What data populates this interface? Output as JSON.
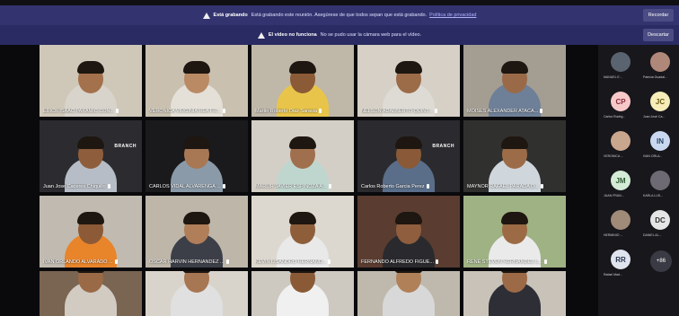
{
  "banner_recording": {
    "title": "Está grabando",
    "text": "Está grabando este reunión. Asegúrese de que todos sepan que está grabando.",
    "link": "Política de privacidad",
    "button": "Recordar"
  },
  "banner_video": {
    "title": "El vídeo no funciona",
    "text": "No se pudo usar la cámara web para el vídeo.",
    "button": "Descartar"
  },
  "tile_logo_text": "BRANCH",
  "tiles": [
    {
      "name": "ERICK ISAAC PAXAMIC CON...",
      "bg": "#cfc7b8",
      "shirt": "#d8d3cb",
      "skin": "#a3714c"
    },
    {
      "name": "VERONICA VIRGINIA REA FR...",
      "bg": "#c9c0b0",
      "shirt": "#e4e0d8",
      "skin": "#b98a64"
    },
    {
      "name": "Martin Roberto Diaz Saravia",
      "bg": "#bfb7a8",
      "shirt": "#e8c54a",
      "skin": "#8b5a36"
    },
    {
      "name": "NELSON ADALBERTO QUINT...",
      "bg": "#d6d0c6",
      "shirt": "#dedbd4",
      "skin": "#9c6b48"
    },
    {
      "name": "MOISES ALEXANDER ATACA...",
      "bg": "#a39d92",
      "shirt": "#6e7f98",
      "skin": "#9a6a48"
    },
    {
      "name": "Juan Jose Caceres Chiquillo",
      "bg": "#2c2c30",
      "shirt": "#b7bdc6",
      "skin": "#8e5e3c"
    },
    {
      "name": "CARLOS VIDAL ALVARENGA ...",
      "bg": "#1a1a1d",
      "shirt": "#8a9aa8",
      "skin": "#a87854"
    },
    {
      "name": "MARLIR JAVIER ESPINOZA A...",
      "bg": "#d4cfc6",
      "shirt": "#bfd6cf",
      "skin": "#a0704e"
    },
    {
      "name": "Carlos Roberto Garcia Perez",
      "bg": "#2b2b2f",
      "shirt": "#5a6e8a",
      "skin": "#8a5a38"
    },
    {
      "name": "MAYNOR RAFAEL PARADA D...",
      "bg": "#30302f",
      "shirt": "#cfd6dc",
      "skin": "#9c6c48"
    },
    {
      "name": "IVAN ORLANDO ALVARADO ...",
      "bg": "#c0bab0",
      "shirt": "#e8842a",
      "skin": "#8c5a36"
    },
    {
      "name": "OSCAR HARVIN HERNANDEZ ...",
      "bg": "#bdb6a9",
      "shirt": "#3c3f48",
      "skin": "#b07e58"
    },
    {
      "name": "KEVIN LISANDRO HERNAND...",
      "bg": "#ddd8cf",
      "shirt": "#e9e9e9",
      "skin": "#8e5e3a"
    },
    {
      "name": "FERNANDO ALFREDO FIGUE...",
      "bg": "#5a3c30",
      "shirt": "#2a2a2e",
      "skin": "#8e5e3e"
    },
    {
      "name": "RENE STEVEN HERNANDEZ L...",
      "bg": "#9fb284",
      "shirt": "#eaeaea",
      "skin": "#9c6a44"
    },
    {
      "name": "",
      "bg": "#7a6452",
      "shirt": "#d1cbc2",
      "skin": "#9a6a46"
    },
    {
      "name": "",
      "bg": "#d9d4cb",
      "shirt": "#e0e0e0",
      "skin": "#a77652"
    },
    {
      "name": "",
      "bg": "#cdc8c0",
      "shirt": "#f0f0f0",
      "skin": "#8a5a36"
    },
    {
      "name": "",
      "bg": "#bfb9ad",
      "shirt": "#d8d8d8",
      "skin": "#b08058"
    },
    {
      "name": "",
      "bg": "#c8c2b8",
      "shirt": "#2e2e36",
      "skin": "#9c6a46"
    }
  ],
  "participants": [
    {
      "initials": "",
      "name": "MANUEL E...",
      "color": "#5a6470",
      "photo": true
    },
    {
      "initials": "",
      "name": "Patricia Guadal...",
      "color": "#b0887a",
      "photo": true
    },
    {
      "initials": "CP",
      "name": "Carlos Rodrig...",
      "color": "#f6c9c8",
      "text": "#8a2a3a",
      "photo": false
    },
    {
      "initials": "JC",
      "name": "Juan José Ca...",
      "color": "#f6edb8",
      "text": "#6b5a10",
      "photo": false
    },
    {
      "initials": "",
      "name": "VERONICA ...",
      "color": "#c9a68e",
      "photo": true
    },
    {
      "initials": "IN",
      "name": "IVAN ORLA...",
      "color": "#c9d8ef",
      "text": "#27446a",
      "photo": false
    },
    {
      "initials": "JM",
      "name": "JUAN FRAN...",
      "color": "#d4ecd6",
      "text": "#2b5a31",
      "photo": false
    },
    {
      "initials": "",
      "name": "KARLA LUS...",
      "color": "#6d6a74",
      "photo": true
    },
    {
      "initials": "",
      "name": "HERMINIO ...",
      "color": "#a08a78",
      "photo": true
    },
    {
      "initials": "DC",
      "name": "DANIEL AL...",
      "color": "#e5e5e5",
      "text": "#333333",
      "photo": false
    },
    {
      "initials": "RR",
      "name": "Rafael Mart...",
      "color": "#dfe4ee",
      "text": "#2a3550",
      "photo": false
    }
  ],
  "more_label": "+86"
}
